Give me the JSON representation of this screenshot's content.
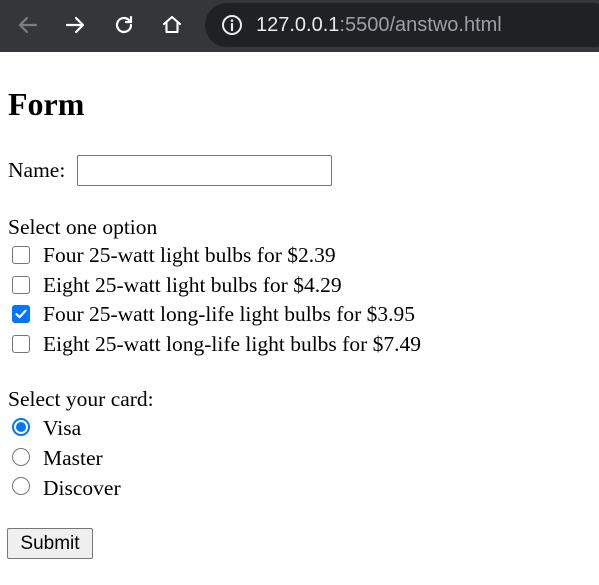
{
  "browser": {
    "url_host": "127.0.0.1",
    "url_rest": ":5500/anstwo.html"
  },
  "form": {
    "title": "Form",
    "name_label": "Name:",
    "name_value": "",
    "options_heading": "Select one option",
    "options": [
      {
        "label": "Four 25-watt light bulbs for $2.39",
        "checked": false
      },
      {
        "label": "Eight 25-watt light bulbs for $4.29",
        "checked": false
      },
      {
        "label": "Four 25-watt long-life light bulbs for $3.95",
        "checked": true
      },
      {
        "label": "Eight 25-watt long-life light bulbs for $7.49",
        "checked": false
      }
    ],
    "card_heading": "Select your card:",
    "cards": [
      {
        "label": "Visa",
        "selected": true
      },
      {
        "label": "Master",
        "selected": false
      },
      {
        "label": "Discover",
        "selected": false
      }
    ],
    "submit_label": "Submit"
  },
  "colors": {
    "toolbar": "#35363a",
    "omnibox": "#202124",
    "accent": "#0075ff"
  }
}
